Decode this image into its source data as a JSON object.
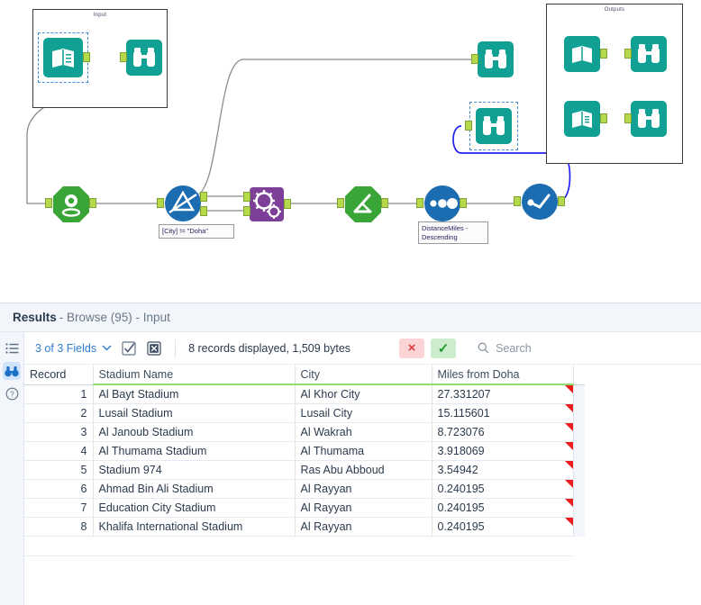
{
  "canvas": {
    "containers": [
      {
        "label": "Input"
      },
      {
        "label": "Outputs"
      }
    ],
    "annotations": [
      {
        "text": "[City] != \"Doha\""
      },
      {
        "text": "DistanceMiles -\nDescending"
      }
    ],
    "nodes": [
      {
        "name": "input-data-tool",
        "icon": "book-icon",
        "selected": true
      },
      {
        "name": "browse-tool-input",
        "icon": "binoculars-icon",
        "selected": false
      },
      {
        "name": "browse-tool-top",
        "icon": "binoculars-icon",
        "selected": false
      },
      {
        "name": "browse-tool-selected",
        "icon": "binoculars-icon",
        "selected": true
      },
      {
        "name": "output-book-1",
        "icon": "book-icon",
        "selected": false
      },
      {
        "name": "output-browse-1",
        "icon": "binoculars-icon",
        "selected": false
      },
      {
        "name": "output-book-2",
        "icon": "book-icon",
        "selected": false
      },
      {
        "name": "output-browse-2",
        "icon": "binoculars-icon",
        "selected": false
      },
      {
        "name": "geocoder-tool",
        "icon": "map-pin-icon",
        "selected": false
      },
      {
        "name": "filter-tool",
        "icon": "filter-triangle-icon",
        "selected": false
      },
      {
        "name": "spatial-process-tool",
        "icon": "gears-icon",
        "selected": false
      },
      {
        "name": "formula-tool",
        "icon": "formula-icon",
        "selected": false
      },
      {
        "name": "sort-tool",
        "icon": "three-dots-icon",
        "selected": false
      },
      {
        "name": "select-tool",
        "icon": "check-line-icon",
        "selected": false
      }
    ],
    "colors": {
      "teal": "#11a094",
      "green": "#3aa537",
      "blue": "#1b6cb0",
      "purple": "#7e3f98",
      "plug": "#b5d94b",
      "selection": "#3f8edc",
      "wire": "#8a8a8a",
      "wire_selected": "#2222ee"
    }
  },
  "results": {
    "title_strong": "Results",
    "title_rest": "- Browse (95) - Input",
    "rail": [
      {
        "name": "list-view-icon",
        "active": false
      },
      {
        "name": "browse-icon",
        "active": true
      },
      {
        "name": "help-icon",
        "active": false
      }
    ],
    "toolbar": {
      "fields_label": "3 of 3 Fields",
      "chevron": "⌄",
      "select_all_icon": "checkbox-checked-icon",
      "deselect_all_icon": "checkbox-x-icon",
      "records_label": "8 records displayed, 1,509 bytes",
      "cancel_label": "×",
      "confirm_label": "✓",
      "search_icon": "search-icon",
      "search_placeholder": "Search",
      "search_value": ""
    },
    "grid": {
      "columns": [
        "Record",
        "Stadium Name",
        "City",
        "Miles from Doha"
      ],
      "rows": [
        {
          "record": "1",
          "stadium": "Al Bayt Stadium",
          "city": "Al Khor City",
          "miles": "27.331207"
        },
        {
          "record": "2",
          "stadium": "Lusail Stadium",
          "city": "Lusail City",
          "miles": "15.115601"
        },
        {
          "record": "3",
          "stadium": "Al Janoub Stadium",
          "city": "Al Wakrah",
          "miles": "8.723076"
        },
        {
          "record": "4",
          "stadium": "Al Thumama Stadium",
          "city": "Al Thumama",
          "miles": "3.918069"
        },
        {
          "record": "5",
          "stadium": "Stadium 974",
          "city": "Ras Abu Abboud",
          "miles": "3.54942"
        },
        {
          "record": "6",
          "stadium": "Ahmad Bin Ali Stadium",
          "city": "Al Rayyan",
          "miles": "0.240195"
        },
        {
          "record": "7",
          "stadium": "Education City Stadium",
          "city": "Al Rayyan",
          "miles": "0.240195"
        },
        {
          "record": "8",
          "stadium": "Khalifa International Stadium",
          "city": "Al Rayyan",
          "miles": "0.240195"
        }
      ]
    }
  }
}
